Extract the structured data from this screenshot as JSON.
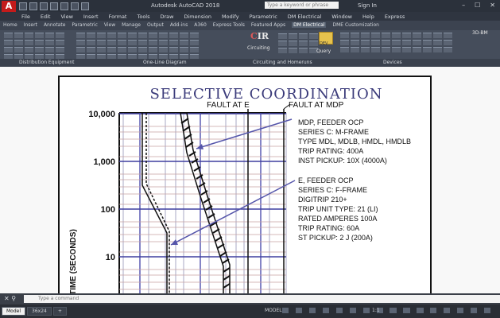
{
  "window": {
    "app_title": "Autodesk AutoCAD 2018",
    "search_placeholder": "Type a keyword or phrase",
    "sign_in": "Sign In"
  },
  "menubar": [
    "File",
    "Edit",
    "View",
    "Insert",
    "Format",
    "Tools",
    "Draw",
    "Dimension",
    "Modify",
    "Parametric",
    "DM Electrical",
    "Window",
    "Help",
    "Express"
  ],
  "ribbon_tabs": {
    "items": [
      "Home",
      "Insert",
      "Annotate",
      "Parametric",
      "View",
      "Manage",
      "Output",
      "Add-ins",
      "A360",
      "Express Tools",
      "Featured Apps",
      "DM Electrical",
      "DME Customization"
    ],
    "active_index": 11
  },
  "ribbon": {
    "circuiting_label": "Circuiting",
    "query_badge": "DEV",
    "query_label": "Query",
    "bm_label": "3D-BM",
    "groups": [
      "Distribution Equipment",
      "One-Line Diagram",
      "Circuiting and Homeruns",
      "Devices"
    ]
  },
  "drawing": {
    "title": "SELECTIVE COORDINATION",
    "fault_e": "FAULT AT E",
    "fault_mdp": "FAULT AT MDP",
    "yaxis_label": "TIME (SECONDS)",
    "ticks": [
      "10,000",
      "1,000",
      "100",
      "10"
    ],
    "note_mdp": [
      "MDP, FEEDER OCP",
      "SERIES C: M-FRAME",
      "TYPE MDL, MDLB, HMDL, HMDLB",
      "TRIP RATING: 400A",
      "INST PICKUP: 10X (4000A)"
    ],
    "note_e": [
      "E, FEEDER OCP",
      "SERIES C: F-FRAME",
      "DIGITRIP 210+",
      "TRIP UNIT TYPE: 21 (LI)",
      "RATED AMPERES 100A",
      "TRIP RATING: 60A",
      "ST PICKUP: 2 J (200A)"
    ]
  },
  "command": {
    "placeholder": "Type a command"
  },
  "status": {
    "tabs": [
      "Model",
      "36x24"
    ],
    "mode": "MODEL",
    "scale": "1:1"
  }
}
